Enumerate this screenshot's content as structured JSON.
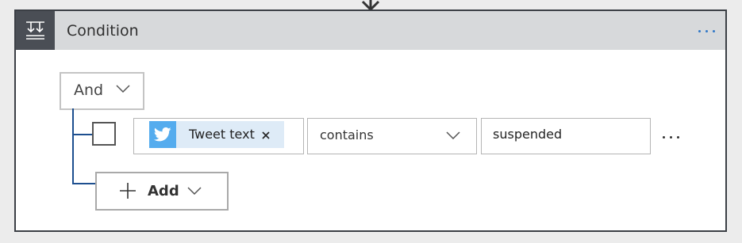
{
  "card": {
    "title": "Condition",
    "header_icon": "condition-icon",
    "more_icon": "ellipsis-icon"
  },
  "group": {
    "operator_label": "And",
    "operator_icon": "chevron-down-icon"
  },
  "rule": {
    "checked": false,
    "token": {
      "label": "Tweet text",
      "icon": "twitter-icon",
      "remove_symbol": "×"
    },
    "operator": {
      "value": "contains",
      "icon": "chevron-down-icon"
    },
    "value": "suspended",
    "more_icon": "ellipsis-icon"
  },
  "add_button": {
    "label": "Add",
    "icon": "plus-icon",
    "dropdown_icon": "chevron-down-icon"
  },
  "colors": {
    "header_bg": "#d7d9db",
    "header_icon_bg": "#4a4e55",
    "token_chip_bg": "#deebf7",
    "twitter_blue": "#55acee",
    "tree_line": "#1d4f8f",
    "accent": "#2f77c7"
  }
}
